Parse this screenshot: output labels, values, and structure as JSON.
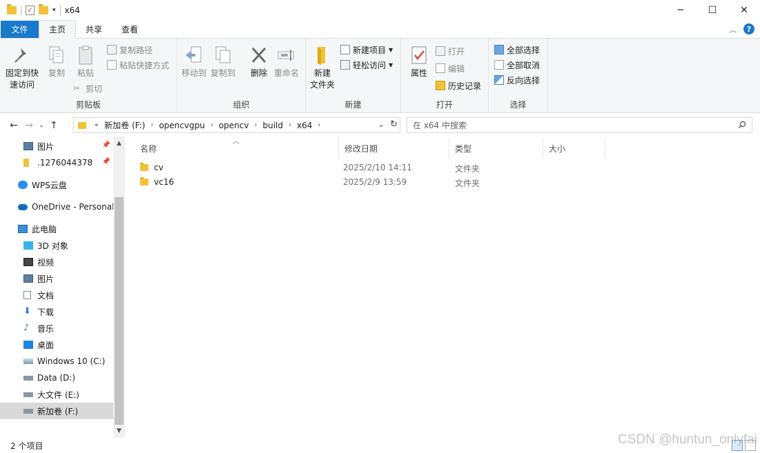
{
  "window": {
    "title": "x64",
    "controls": {
      "minimize": "─",
      "maximize": "☐",
      "close": "✕"
    }
  },
  "ribbon_tabs": {
    "file": "文件",
    "home": "主页",
    "share": "共享",
    "view": "查看"
  },
  "ribbon": {
    "clipboard": {
      "label": "剪贴板",
      "pin_quick_access_1": "固定到快",
      "pin_quick_access_2": "速访问",
      "copy": "复制",
      "paste": "粘贴",
      "copy_path": "复制路径",
      "paste_shortcut": "粘贴快捷方式",
      "cut": "剪切"
    },
    "organize": {
      "label": "组织",
      "move_to": "移动到",
      "copy_to": "复制到",
      "delete": "删除",
      "rename": "重命名"
    },
    "new": {
      "label": "新建",
      "new_folder_1": "新建",
      "new_folder_2": "文件夹",
      "new_item": "新建项目",
      "easy_access": "轻松访问"
    },
    "open": {
      "label": "打开",
      "properties": "属性",
      "open": "打开",
      "edit": "编辑",
      "history": "历史记录"
    },
    "select": {
      "label": "选择",
      "select_all": "全部选择",
      "select_none": "全部取消",
      "invert": "反向选择"
    }
  },
  "address": {
    "overflow": "«",
    "crumbs": [
      "新加卷 (F:)",
      "opencvgpu",
      "opencv",
      "build",
      "x64"
    ]
  },
  "search": {
    "placeholder": "在 x64 中搜索"
  },
  "nav_pane": {
    "items": [
      {
        "label": "图片",
        "pinned": true
      },
      {
        "label": ".1276044378",
        "pinned": true
      },
      {
        "label": "WPS云盘"
      },
      {
        "label": "OneDrive - Personal"
      },
      {
        "label": "此电脑"
      },
      {
        "label": "3D 对象"
      },
      {
        "label": "视频"
      },
      {
        "label": "图片"
      },
      {
        "label": "文档"
      },
      {
        "label": "下载"
      },
      {
        "label": "音乐"
      },
      {
        "label": "桌面"
      },
      {
        "label": "Windows 10 (C:)"
      },
      {
        "label": "Data (D:)"
      },
      {
        "label": "大文件 (E:)"
      },
      {
        "label": "新加卷 (F:)",
        "selected": true
      }
    ]
  },
  "columns": {
    "name": "名称",
    "modified": "修改日期",
    "type": "类型",
    "size": "大小"
  },
  "files": [
    {
      "name": "cv",
      "modified": "2025/2/10 14:11",
      "type": "文件夹",
      "size": ""
    },
    {
      "name": "vc16",
      "modified": "2025/2/9 13:59",
      "type": "文件夹",
      "size": ""
    }
  ],
  "status": {
    "item_count": "2 个项目"
  },
  "watermark": "CSDN @huntun_onlyfai",
  "colors": {
    "accent": "#1979ca",
    "folder": "#f0c239"
  }
}
